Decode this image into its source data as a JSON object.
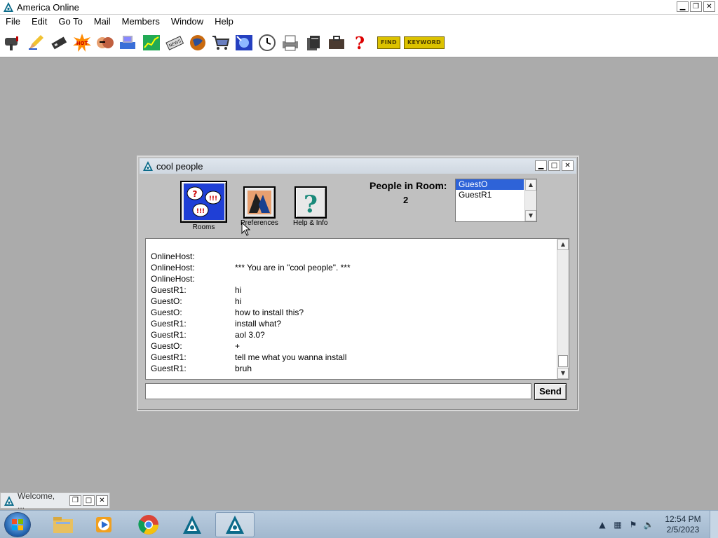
{
  "app": {
    "title": "America  Online",
    "window_buttons": [
      "minimize",
      "restore",
      "close"
    ]
  },
  "menubar": {
    "items": [
      "File",
      "Edit",
      "Go To",
      "Mail",
      "Members",
      "Window",
      "Help"
    ]
  },
  "toolbar": {
    "icons": [
      "mailbox-icon",
      "pencil-icon",
      "printer-icon",
      "hot-starburst-icon",
      "people-faces-icon",
      "modem-icon",
      "chart-icon",
      "news-icon",
      "globe-icon",
      "shopping-cart-icon",
      "search-globe-icon",
      "clock-icon",
      "printer-paper-icon",
      "files-icon",
      "briefcase-icon",
      "help-question-icon"
    ],
    "find_label": "FIND",
    "keyword_label": "KEYWORD"
  },
  "chat_window": {
    "title": "cool people",
    "buttons": {
      "rooms": "Rooms",
      "preferences": "Preferences",
      "help_info": "Help & Info"
    },
    "people_label": "People in Room:",
    "people_count": "2",
    "people": [
      "GuestO",
      "GuestR1"
    ],
    "selected_person": "GuestO",
    "log": [
      {
        "who": "OnlineHost:",
        "text": ""
      },
      {
        "who": "OnlineHost:",
        "text": "*** You are in \"cool people\". ***"
      },
      {
        "who": "OnlineHost:",
        "text": ""
      },
      {
        "who": "GuestR1:",
        "text": "hi"
      },
      {
        "who": "GuestO:",
        "text": "hi"
      },
      {
        "who": "GuestO:",
        "text": "how to install this?"
      },
      {
        "who": "GuestR1:",
        "text": "install what?"
      },
      {
        "who": "GuestR1:",
        "text": "aol 3.0?"
      },
      {
        "who": "GuestO:",
        "text": "+"
      },
      {
        "who": "GuestR1:",
        "text": "tell me what you wanna install"
      },
      {
        "who": "GuestR1:",
        "text": "bruh"
      }
    ],
    "input_value": "",
    "send_label": "Send"
  },
  "minimized_window": {
    "label": "Welcome, ..."
  },
  "taskbar": {
    "items": [
      "explorer-folder-icon",
      "media-player-icon",
      "chrome-icon",
      "aol-icon",
      "aol-icon"
    ],
    "active_item": 4,
    "tray": [
      "show-hidden-icon",
      "network-icon",
      "action-center-icon",
      "volume-icon"
    ],
    "time": "12:54 PM",
    "date": "2/5/2023"
  },
  "colors": {
    "selection": "#2e63d8",
    "desktop_gray": "#ababab",
    "taskbar": "#a9bdd2"
  }
}
